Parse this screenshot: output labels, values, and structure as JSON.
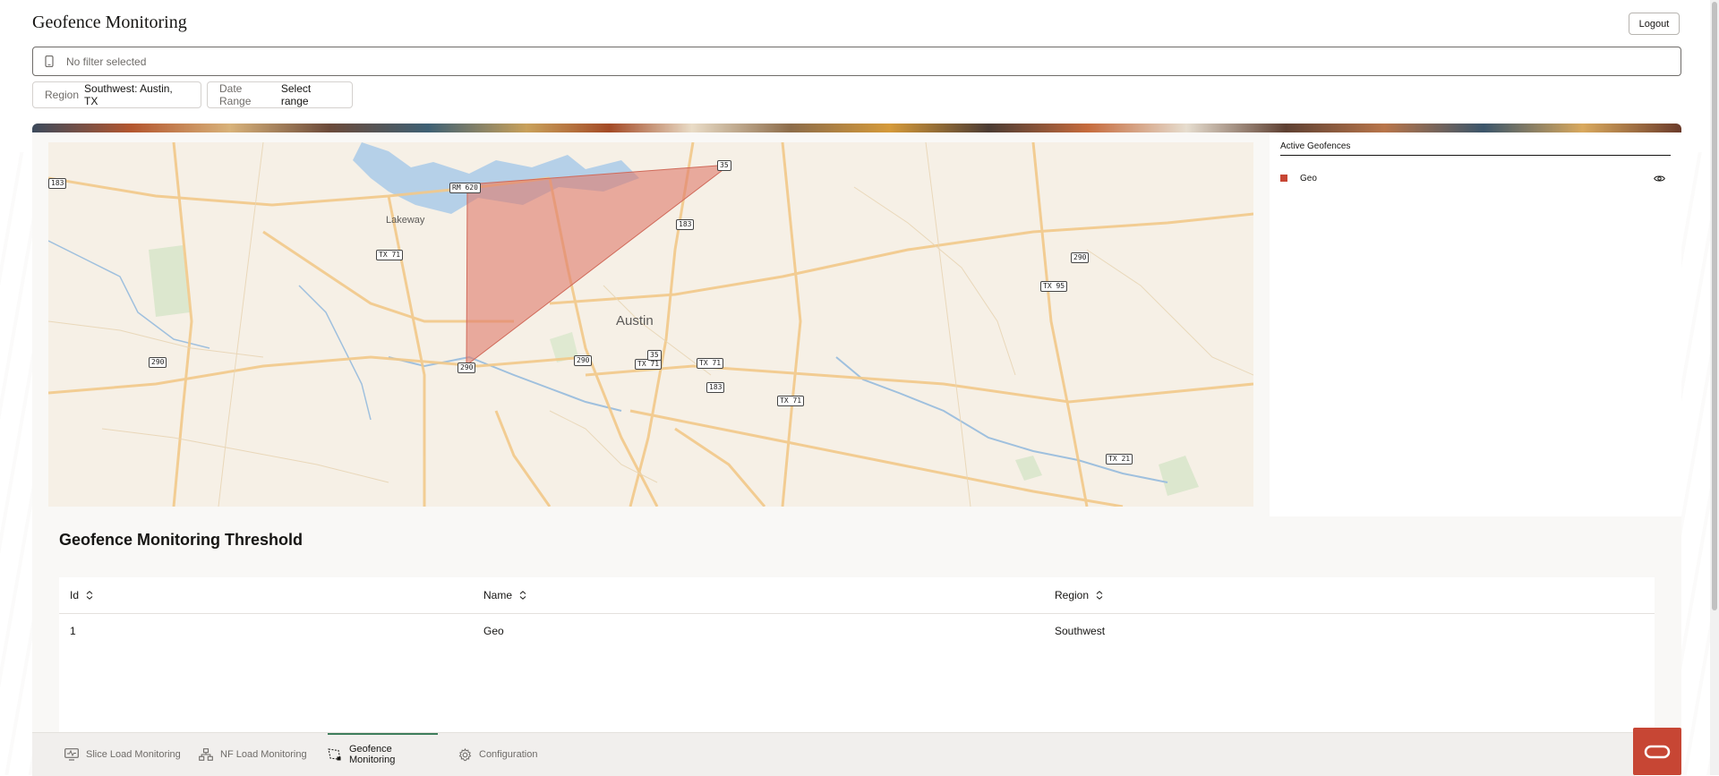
{
  "header": {
    "title": "Geofence Monitoring",
    "logout_label": "Logout"
  },
  "filter": {
    "placeholder": "No filter selected",
    "icon": "device-icon"
  },
  "chips": {
    "region_label": "Region",
    "region_value": "Southwest: Austin, TX",
    "date_label": "Date Range",
    "date_value": "Select range"
  },
  "map": {
    "city_label": "Austin",
    "place_labels": [
      "Lakeway"
    ],
    "road_shields": [
      "183",
      "RM 620",
      "TX 71",
      "290",
      "35",
      "183",
      "TX 95",
      "290",
      "290",
      "TX 71",
      "35",
      "TX 71",
      "183",
      "TX 71",
      "TX 21",
      "290"
    ],
    "geofence_color": "#e07a6a"
  },
  "side_panel": {
    "heading": "Active Geofences",
    "geofences": [
      {
        "name": "Geo",
        "color": "#c74634",
        "icon": "eye-icon"
      }
    ]
  },
  "threshold": {
    "title": "Geofence Monitoring Threshold",
    "columns": [
      "Id",
      "Name",
      "Region"
    ],
    "rows": [
      {
        "id": "1",
        "name": "Geo",
        "region": "Southwest"
      }
    ]
  },
  "nav": {
    "items": [
      {
        "label": "Slice Load Monitoring",
        "icon": "monitor-icon"
      },
      {
        "label": "NF Load Monitoring",
        "icon": "network-icon"
      },
      {
        "label": "Geofence Monitoring",
        "icon": "geofence-icon",
        "active": true
      },
      {
        "label": "Configuration",
        "icon": "gear-icon"
      }
    ]
  },
  "colors": {
    "brand": "#c74634",
    "active_tab": "#3e7e5c"
  }
}
